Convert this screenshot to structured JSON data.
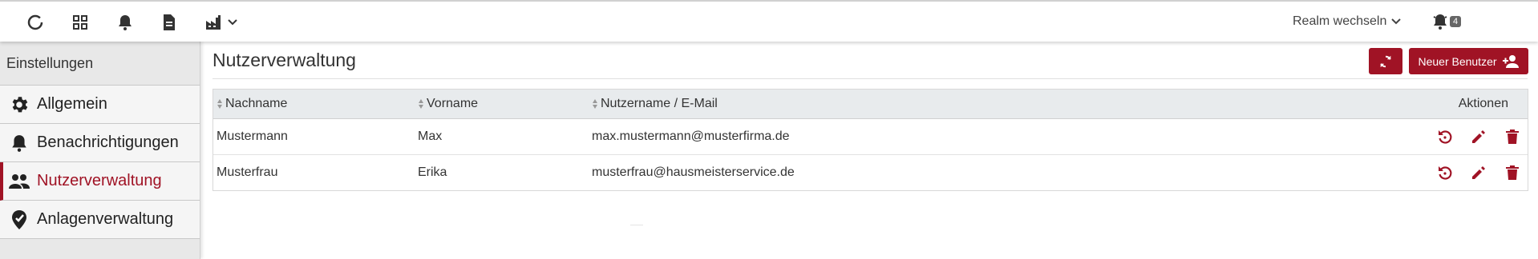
{
  "topbar": {
    "icons": [
      "loading-icon",
      "grid-icon",
      "bell-icon",
      "document-icon",
      "factory-icon"
    ],
    "realm_label": "Realm wechseln",
    "notification_count": "4"
  },
  "sidebar": {
    "title": "Einstellungen",
    "items": [
      {
        "label": "Allgemein",
        "icon": "gear-icon"
      },
      {
        "label": "Benachrichtigungen",
        "icon": "bell-icon"
      },
      {
        "label": "Nutzerverwaltung",
        "icon": "users-icon",
        "active": true
      },
      {
        "label": "Anlagenverwaltung",
        "icon": "location-check-icon"
      }
    ]
  },
  "main": {
    "title": "Nutzerverwaltung",
    "new_user_label": "Neuer Benutzer",
    "table": {
      "headers": {
        "lastname": "Nachname",
        "firstname": "Vorname",
        "username": "Nutzername / E-Mail",
        "actions": "Aktionen"
      },
      "rows": [
        {
          "lastname": "Mustermann",
          "firstname": "Max",
          "email": "max.mustermann@musterfirma.de"
        },
        {
          "lastname": "Musterfrau",
          "firstname": "Erika",
          "email": "musterfrau@hausmeisterservice.de"
        }
      ]
    }
  },
  "colors": {
    "accent": "#a01325",
    "sidebar_bg": "#e8e8e8",
    "header_bg": "#e8ebed"
  }
}
